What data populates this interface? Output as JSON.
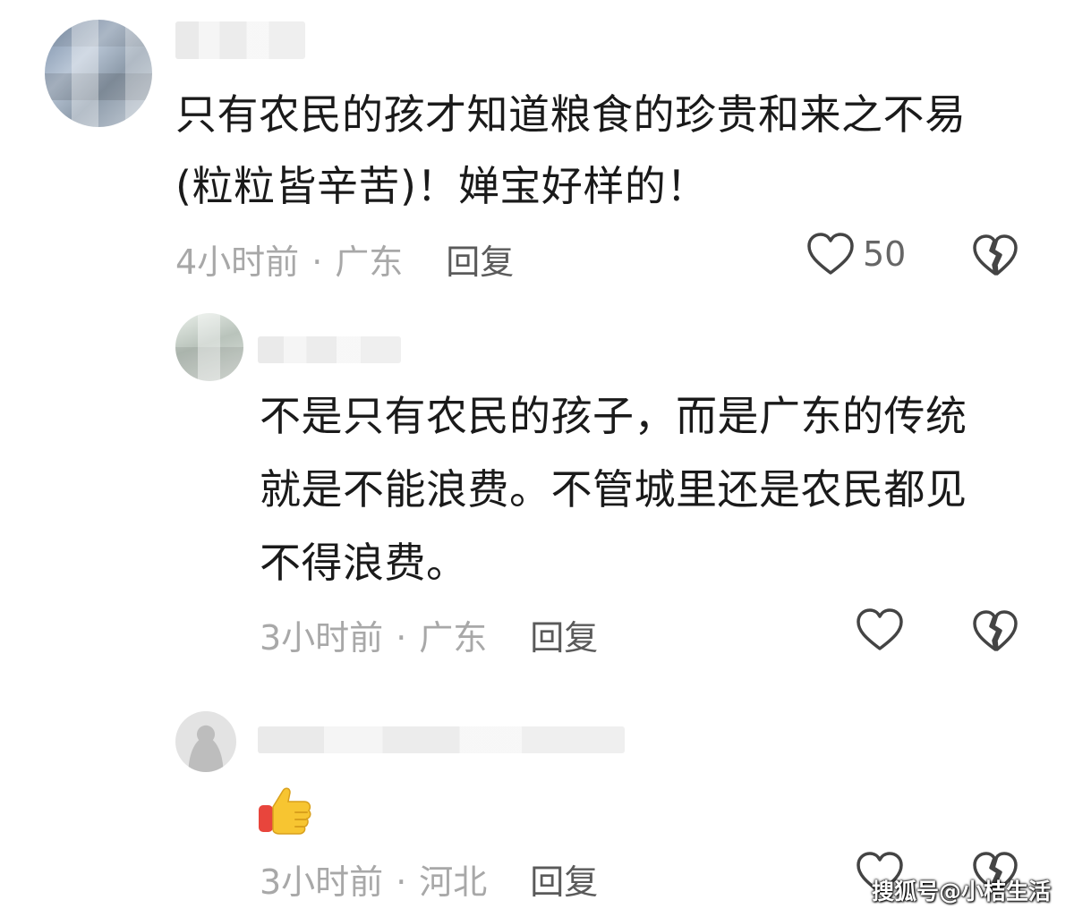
{
  "comments": [
    {
      "lines": [
        "只有农民的孩才知道粮食的珍贵和来之不易",
        "(粒粒皆辛苦)！婵宝好样的！"
      ],
      "time": "4小时前",
      "dot": "·",
      "location": "广东",
      "reply": "回复",
      "likes": "50",
      "like_icon": "heart-outline-icon",
      "dislike_icon": "broken-heart-icon"
    },
    {
      "lines": [
        "不是只有农民的孩子，而是广东的传统",
        "就是不能浪费。不管城里还是农民都见",
        "不得浪费。"
      ],
      "time": "3小时前",
      "dot": "·",
      "location": "广东",
      "reply": "回复",
      "likes": "",
      "like_icon": "heart-outline-icon",
      "dislike_icon": "broken-heart-icon"
    },
    {
      "emoji": "thumbs-up",
      "time": "3小时前",
      "dot": "·",
      "location": "河北",
      "reply": "回复",
      "likes": "",
      "like_icon": "heart-outline-icon",
      "dislike_icon": "broken-heart-icon"
    }
  ],
  "watermark": "搜狐号@小桔生活",
  "colors": {
    "meta_text": "#a8a8a8",
    "reply_text": "#5a5a5a",
    "icon_stroke": "#444444",
    "thumb_yellow": "#f7c531",
    "thumb_red": "#e8453c"
  }
}
